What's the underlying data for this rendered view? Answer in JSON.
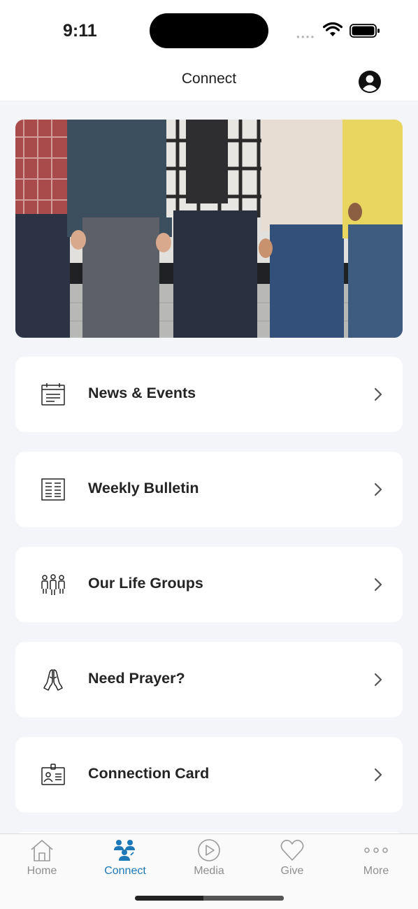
{
  "status": {
    "time": "9:11"
  },
  "header": {
    "title": "Connect"
  },
  "menu": [
    {
      "label": "News & Events",
      "icon": "calendar-news-icon"
    },
    {
      "label": "Weekly Bulletin",
      "icon": "bulletin-icon"
    },
    {
      "label": "Our Life Groups",
      "icon": "people-group-icon"
    },
    {
      "label": "Need Prayer?",
      "icon": "praying-hands-icon"
    },
    {
      "label": "Connection Card",
      "icon": "id-card-icon"
    }
  ],
  "tabs": [
    {
      "label": "Home",
      "icon": "home-icon"
    },
    {
      "label": "Connect",
      "icon": "connect-people-icon"
    },
    {
      "label": "Media",
      "icon": "play-icon"
    },
    {
      "label": "Give",
      "icon": "heart-icon"
    },
    {
      "label": "More",
      "icon": "more-dots-icon"
    }
  ],
  "active_tab": "Connect",
  "colors": {
    "accent": "#1d78b8",
    "background": "#f4f5f9",
    "card": "#ffffff",
    "tab_inactive": "#8f8f8f"
  }
}
